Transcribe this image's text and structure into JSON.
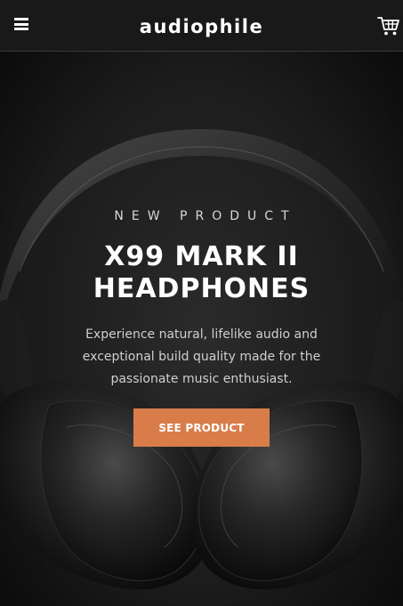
{
  "header": {
    "brand": "audiophile",
    "menu_icon": "hamburger-menu-icon",
    "cart_icon": "cart-icon"
  },
  "hero": {
    "overline": "NEW PRODUCT",
    "title_line1": "X99 MARK II",
    "title_line2": "HEADPHONES",
    "description": "Experience natural, lifelike audio and exceptional build quality made for the passionate music enthusiast.",
    "cta_label": "SEE PRODUCT",
    "background_image": "headphones-photo"
  },
  "colors": {
    "accent": "#d87d4a",
    "header_bg": "#191919",
    "hero_bg": "#191919",
    "text_primary": "#ffffff"
  }
}
